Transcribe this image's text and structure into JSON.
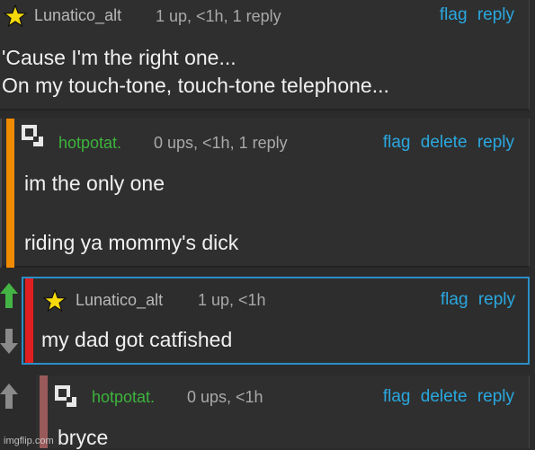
{
  "colors": {
    "background": "#2b2b2b",
    "comment_bg": "#2f2f2f",
    "action_link": "#2aa8e0",
    "meta_text": "#a9a9a9",
    "green_user": "#3cb43c",
    "orange_bar": "#f08a00",
    "red_bar": "#e02020",
    "highlight_border": "#2a8ec8",
    "upvote_green": "#44b544"
  },
  "comments": [
    {
      "user": "Lunatico_alt",
      "user_icon": "star-icon",
      "meta": "1 up, <1h, 1 reply",
      "actions": [
        "flag",
        "reply"
      ],
      "lines": [
        "'Cause I'm the right one...",
        "On my touch-tone, touch-tone telephone..."
      ]
    },
    {
      "user": "hotpotat.",
      "user_icon": "glider-logo-icon",
      "meta": "0 ups, <1h, 1 reply",
      "actions": [
        "flag",
        "delete",
        "reply"
      ],
      "lines": [
        "im the only one",
        "",
        "riding ya mommy's dick"
      ]
    },
    {
      "user": "Lunatico_alt",
      "user_icon": "star-icon",
      "meta": "1 up, <1h",
      "actions": [
        "flag",
        "reply"
      ],
      "lines": [
        "my dad got catfished"
      ]
    },
    {
      "user": "hotpotat.",
      "user_icon": "glider-logo-icon",
      "meta": "0 ups, <1h",
      "actions": [
        "flag",
        "delete",
        "reply"
      ],
      "lines": [
        "bryce"
      ]
    }
  ],
  "watermark": "imgflip.com"
}
